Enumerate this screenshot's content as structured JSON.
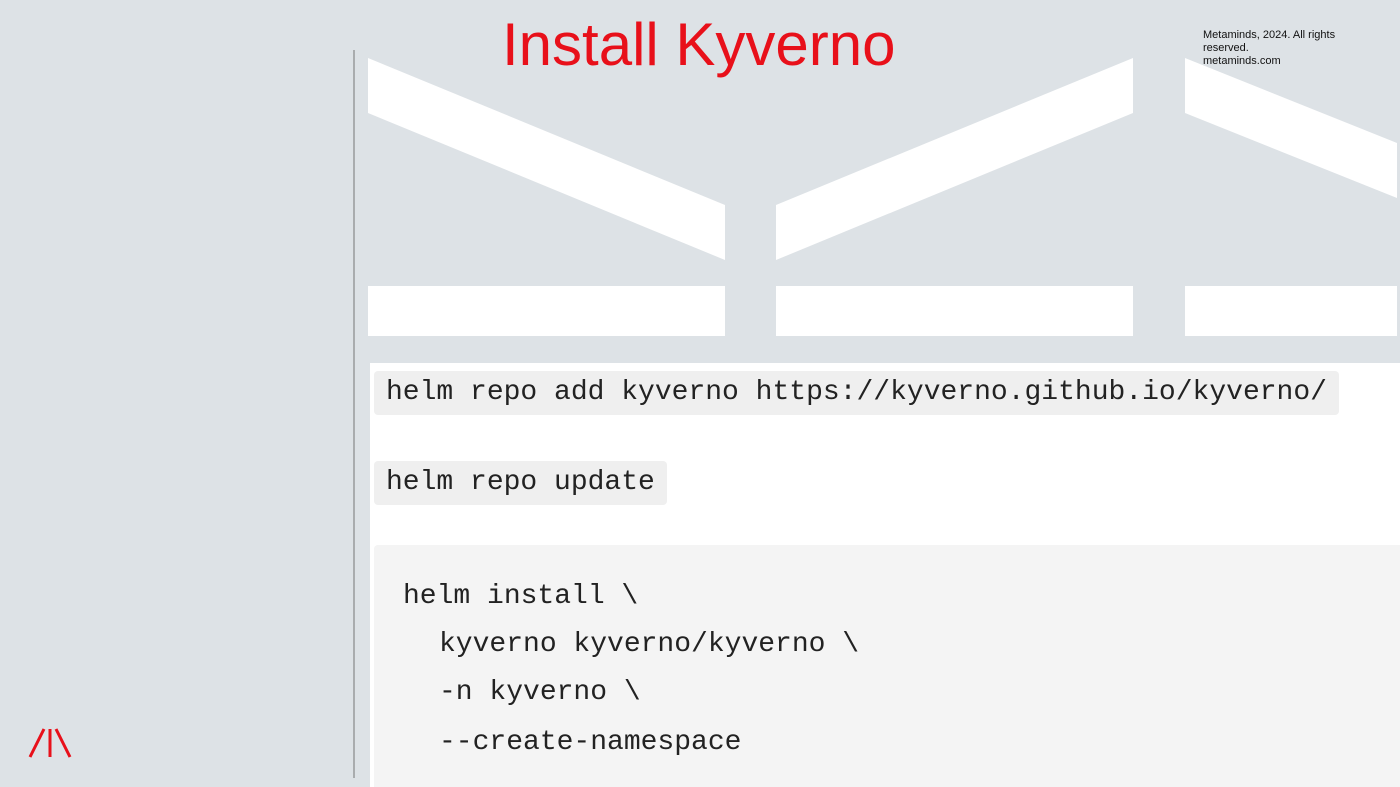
{
  "slide": {
    "title": "Install Kyverno",
    "copyright": {
      "line1": "Metaminds, 2024. All rights",
      "line2": "reserved.",
      "line3": "metaminds.com"
    },
    "logo": {
      "icon": "metaminds-logo-icon",
      "color": "#e8101a"
    }
  },
  "commands": {
    "add_repo": "helm repo add kyverno https://kyverno.github.io/kyverno/",
    "update_repo": "helm repo update",
    "install": [
      "helm install \\",
      "kyverno kyverno/kyverno \\",
      "-n kyverno \\",
      "--create-namespace"
    ]
  },
  "colors": {
    "background": "#dde2e6",
    "accent": "#e8101a",
    "content_panel": "#ffffff",
    "code_background": "#f4f4f4"
  }
}
